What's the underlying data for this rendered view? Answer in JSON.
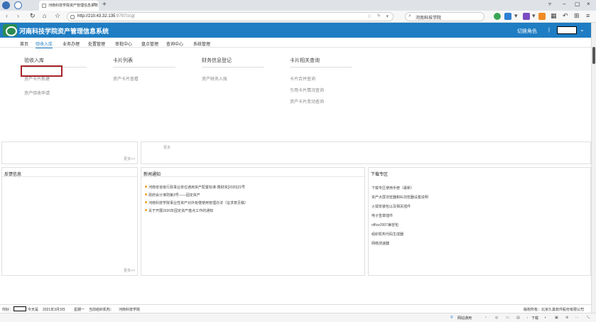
{
  "browser": {
    "tab_title": "河南科技学院资产管理信息系统",
    "url_host": "http://210.43.32.135",
    "url_rest": ":9797/zcgl",
    "search_text": "河南科技学院"
  },
  "app": {
    "title": "河南科技学院资产管理信息系统",
    "switch_role": "切换角色",
    "separator": "|"
  },
  "nav": [
    "首页",
    "验收入库",
    "业务办理",
    "处置管理",
    "审批中心",
    "盘点管理",
    "查询中心",
    "系统管理"
  ],
  "menu": {
    "columns": [
      {
        "header": "验收入库",
        "items": [
          "资产卡片新建",
          "资产验收申请"
        ]
      },
      {
        "header": "卡片列表",
        "items": [
          "资产卡片查看"
        ]
      },
      {
        "header": "财务信息登记",
        "items": [
          "资产财务入账"
        ]
      },
      {
        "header": "卡片相关查询",
        "items": [
          "卡片合并查询",
          "引用卡片情况查询",
          "资产卡片变动查询"
        ]
      }
    ]
  },
  "panels": {
    "more_label": "更多>>",
    "more_label_plain": "更多",
    "feedback_title": "反馈信息",
    "news_title": "新闻通知",
    "news": [
      "河南省省级行政事业单位通用资产配置标准-豫财资[2020]22号",
      "政府会计准则第3号——固定资产",
      "河南科技学院事业性资产对外有偿使用管理办法（征求意见稿）",
      "关于开展2020年固定资产盘点工作的通知"
    ],
    "download_title": "下载专区",
    "downloads": [
      "下载专区使用手册（最新）",
      "资产大屏浏览器和IE浏览器设置说明",
      "火狐安装包以及相关插件",
      "电子签章插件",
      "office2007兼容包",
      "组织机构代码生成器",
      "网络测速器"
    ]
  },
  "statusbar": {
    "greeting_prefix": "你好：",
    "today": "今天是",
    "date": "2021年3月3日",
    "weekday": "星期一",
    "org_label": "当前组织机构：",
    "org": "河南科技学院",
    "copyright": "版权所有：北京久其软件股份有限公司"
  },
  "browser_bottom": {
    "network": "网站通用",
    "download": "下载"
  }
}
